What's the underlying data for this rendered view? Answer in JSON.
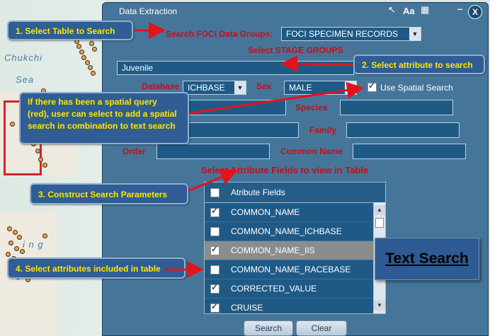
{
  "window": {
    "title": "Data Extraction",
    "close_label": "X"
  },
  "map": {
    "labels": [
      "Chukchi",
      "Sea",
      "i n g"
    ]
  },
  "search_groups": {
    "label": "Search FOCI Data Groups:",
    "value": "FOCI SPECIMEN RECORDS"
  },
  "stage_groups": {
    "label": "Select STAGE GROUPS",
    "value": "Juvenile"
  },
  "database": {
    "label": "Database",
    "value": "ICHBASE"
  },
  "sex": {
    "label": "Sex",
    "value": "MALE"
  },
  "spatial": {
    "label": "Use Spatial Search",
    "checked": true
  },
  "species": {
    "label": "Species"
  },
  "family": {
    "label": "Family"
  },
  "order": {
    "label": "Order"
  },
  "common_name": {
    "label": "Common Name"
  },
  "attributes": {
    "heading": "Select Attribute Fields to view in Table",
    "column_header": "Atribute Fields",
    "rows": [
      {
        "name": "COMMON_NAME",
        "checked": true,
        "selected": false
      },
      {
        "name": "COMMON_NAME_ICHBASE",
        "checked": false,
        "selected": false
      },
      {
        "name": "COMMON_NAME_IIS",
        "checked": true,
        "selected": true
      },
      {
        "name": "COMMON_NAME_RACEBASE",
        "checked": false,
        "selected": false
      },
      {
        "name": "CORRECTED_VALUE",
        "checked": true,
        "selected": false
      },
      {
        "name": "CRUISE",
        "checked": true,
        "selected": false
      }
    ]
  },
  "buttons": {
    "search": "Search",
    "clear": "Clear"
  },
  "callouts": {
    "c1": "1. Select Table to Search",
    "c2": "2. Select attribute to search",
    "c3": "If there has been a spatial query (red), user can select to add a spatial search in combination to text search",
    "c4": "3. Construct Search Parameters",
    "c5": "4. Select attributes included in table"
  },
  "badge": "Text Search",
  "colors": {
    "panel": "#245c8a",
    "callout_text": "#ffe600",
    "red_label": "#c0101a",
    "arrow": "#e3131b"
  }
}
